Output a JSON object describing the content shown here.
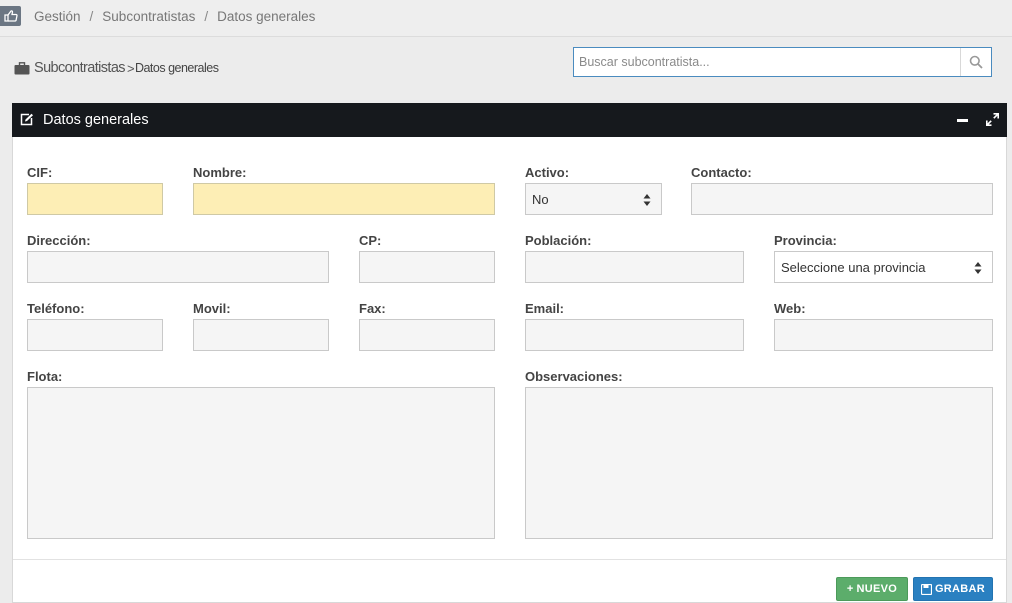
{
  "breadcrumb": {
    "items": [
      "Gestión",
      "Subcontratistas",
      "Datos generales"
    ],
    "separator": "/"
  },
  "page_title": {
    "section": "Subcontratistas",
    "separator": ">",
    "current": "Datos generales",
    "icon": "briefcase-icon"
  },
  "search": {
    "placeholder": "Buscar subcontratista...",
    "icon": "search-icon"
  },
  "panel": {
    "title": "Datos generales",
    "icon": "edit-icon",
    "header_color": "#16191d"
  },
  "form": {
    "cif": {
      "label": "CIF:",
      "value": ""
    },
    "nombre": {
      "label": "Nombre:",
      "value": ""
    },
    "activo": {
      "label": "Activo:",
      "selected": "No"
    },
    "contacto": {
      "label": "Contacto:",
      "value": ""
    },
    "direccion": {
      "label": "Dirección:",
      "value": ""
    },
    "cp": {
      "label": "CP:",
      "value": ""
    },
    "poblacion": {
      "label": "Población:",
      "value": ""
    },
    "provincia": {
      "label": "Provincia:",
      "selected": "Seleccione una provincia"
    },
    "telefono": {
      "label": "Teléfono:",
      "value": ""
    },
    "movil": {
      "label": "Movil:",
      "value": ""
    },
    "fax": {
      "label": "Fax:",
      "value": ""
    },
    "email": {
      "label": "Email:",
      "value": ""
    },
    "web": {
      "label": "Web:",
      "value": ""
    },
    "flota": {
      "label": "Flota:",
      "value": ""
    },
    "observaciones": {
      "label": "Observaciones:",
      "value": ""
    }
  },
  "buttons": {
    "nuevo": "NUEVO",
    "grabar": "GRABAR"
  },
  "colors": {
    "required_field": "#fdeeb5",
    "accent": "#2a80c1",
    "new_button": "#5cad6b"
  }
}
